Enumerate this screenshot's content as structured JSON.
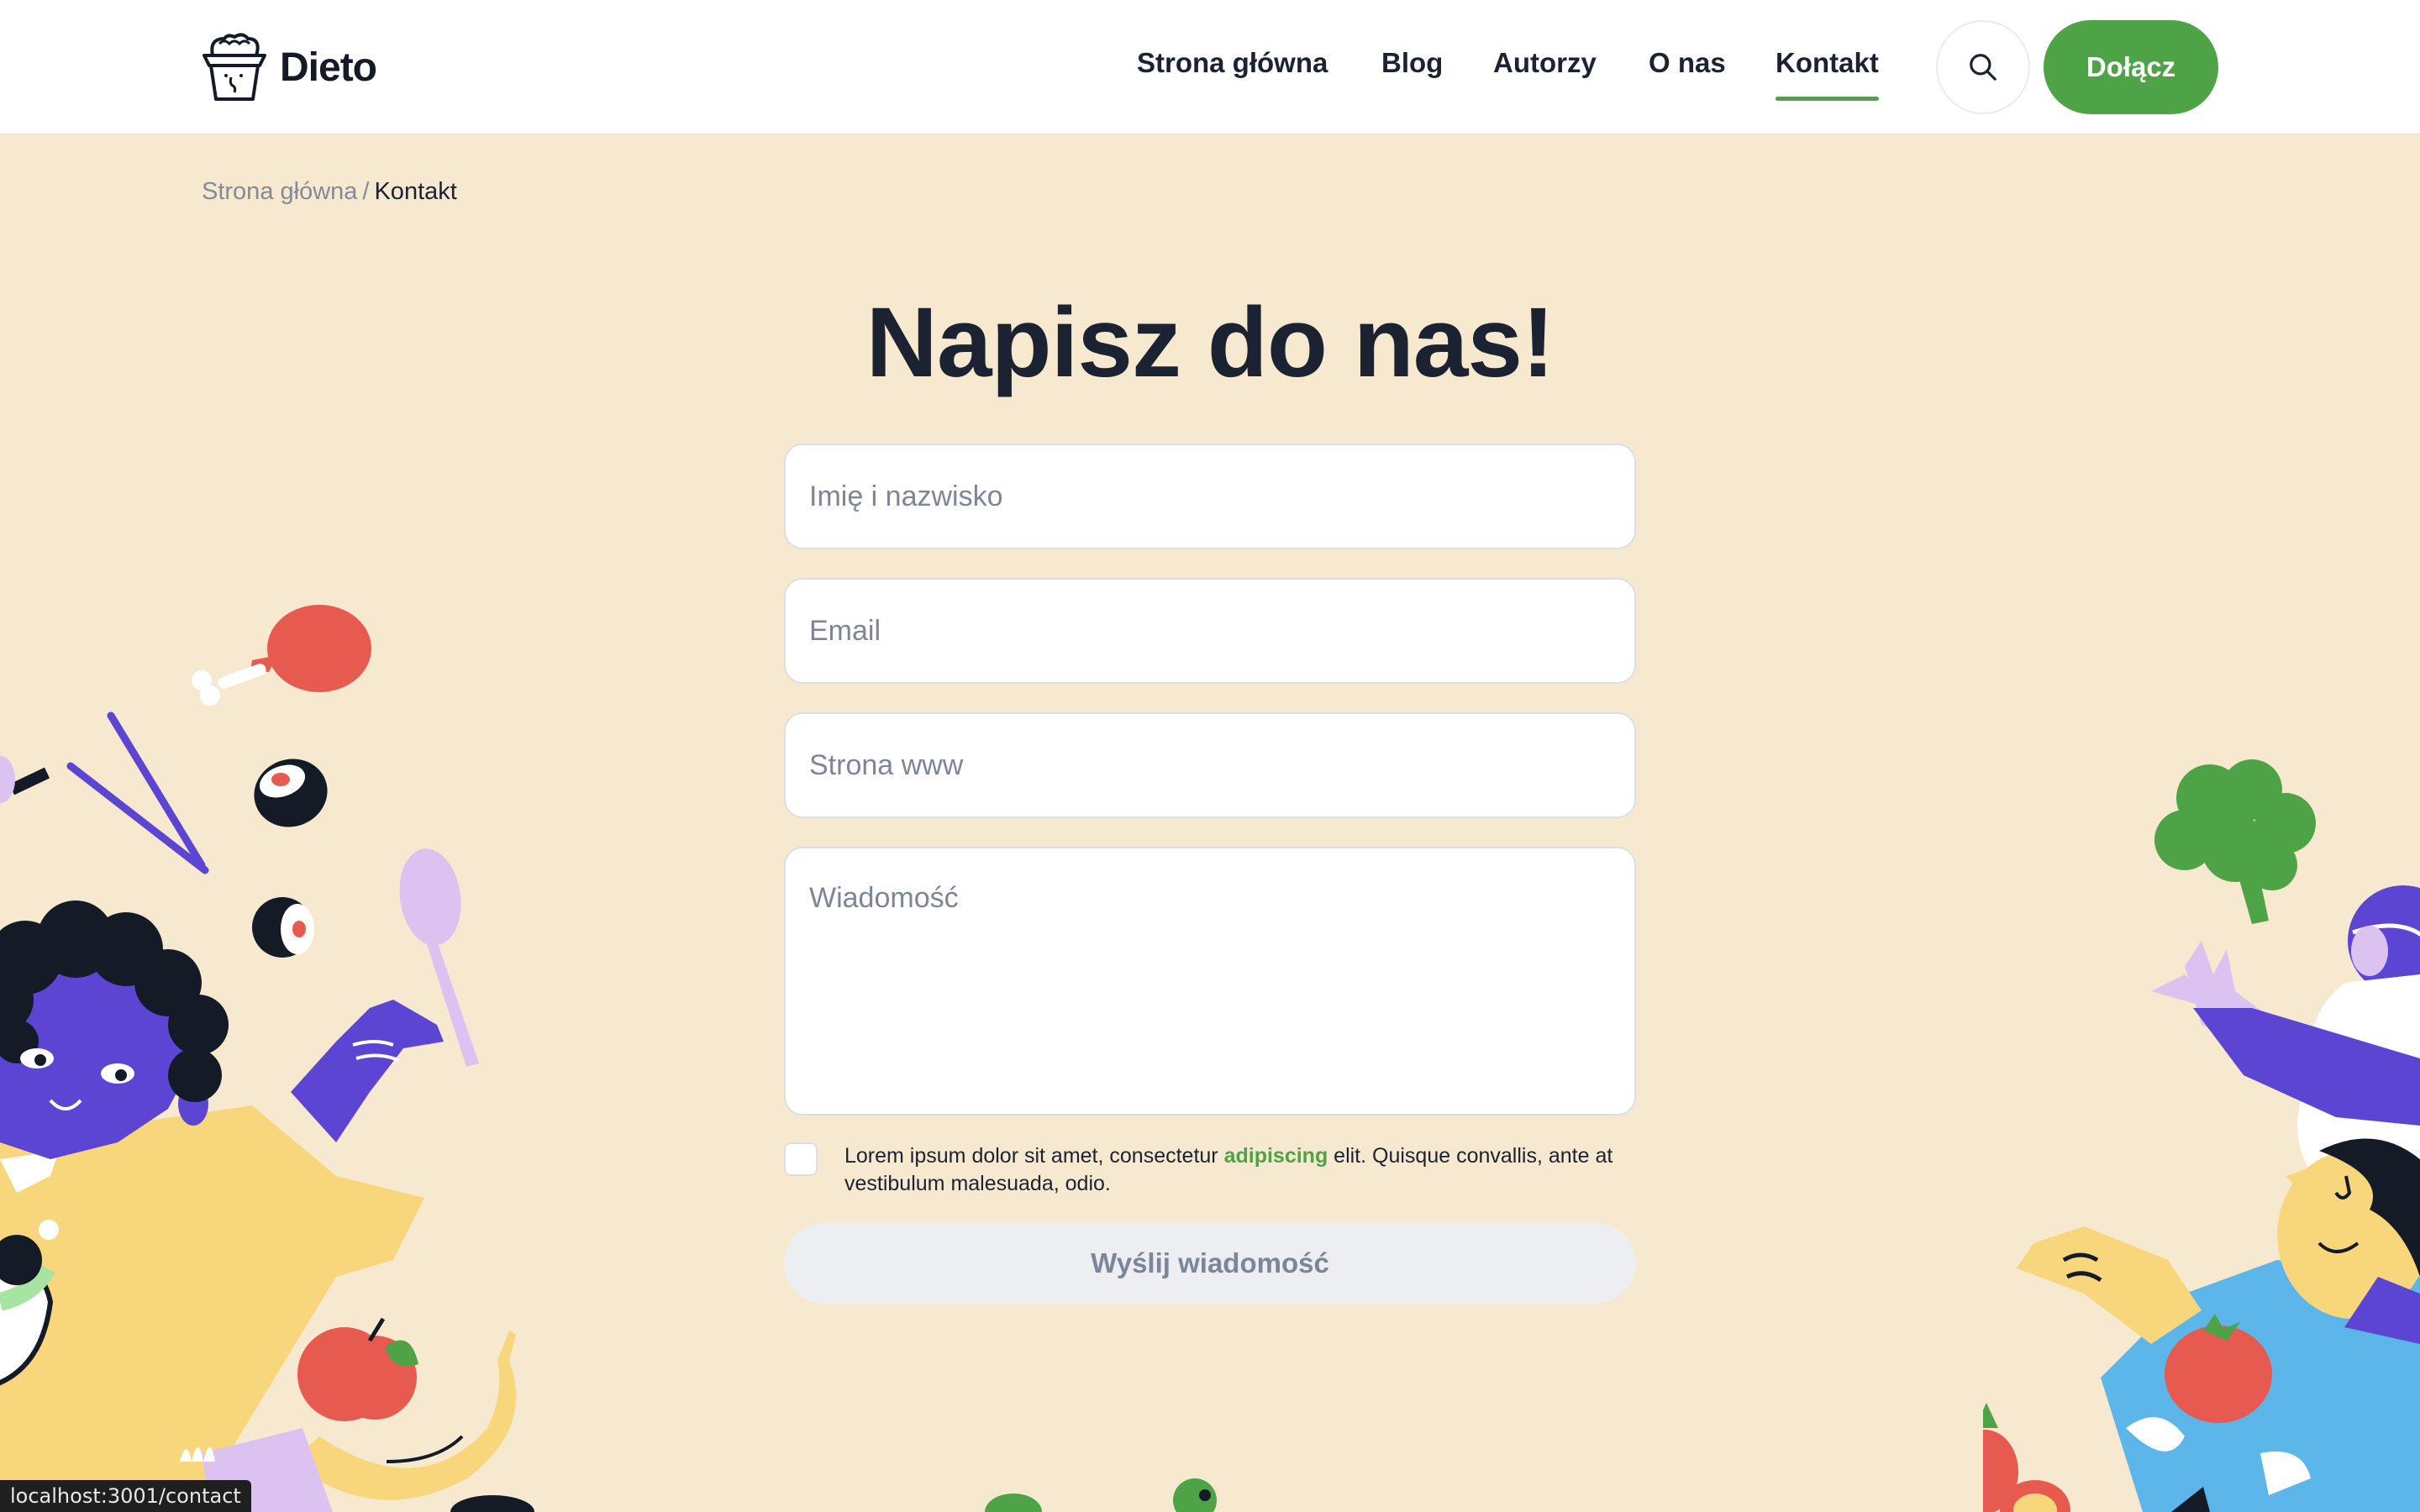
{
  "header": {
    "logo_text": "Dieto",
    "nav": [
      {
        "label": "Strona główna",
        "active": false
      },
      {
        "label": "Blog",
        "active": false
      },
      {
        "label": "Autorzy",
        "active": false
      },
      {
        "label": "O nas",
        "active": false
      },
      {
        "label": "Kontakt",
        "active": true
      }
    ],
    "join_label": "Dołącz"
  },
  "breadcrumb": {
    "home": "Strona główna",
    "separator": "/",
    "current": "Kontakt"
  },
  "page": {
    "title": "Napisz do nas!"
  },
  "form": {
    "name_placeholder": "Imię i nazwisko",
    "email_placeholder": "Email",
    "website_placeholder": "Strona www",
    "message_placeholder": "Wiadomość",
    "consent_before": "Lorem ipsum dolor sit amet, consectetur ",
    "consent_link": "adipiscing",
    "consent_after": " elit. Quisque convallis, ante at vestibulum malesuada, odio.",
    "consent_checked": false,
    "submit_label": "Wyślij wiadomość"
  },
  "statusbar": {
    "url": "localhost:3001/contact"
  },
  "colors": {
    "accent": "#4ea346",
    "background": "#f6e9cf",
    "text": "#1b2232"
  }
}
